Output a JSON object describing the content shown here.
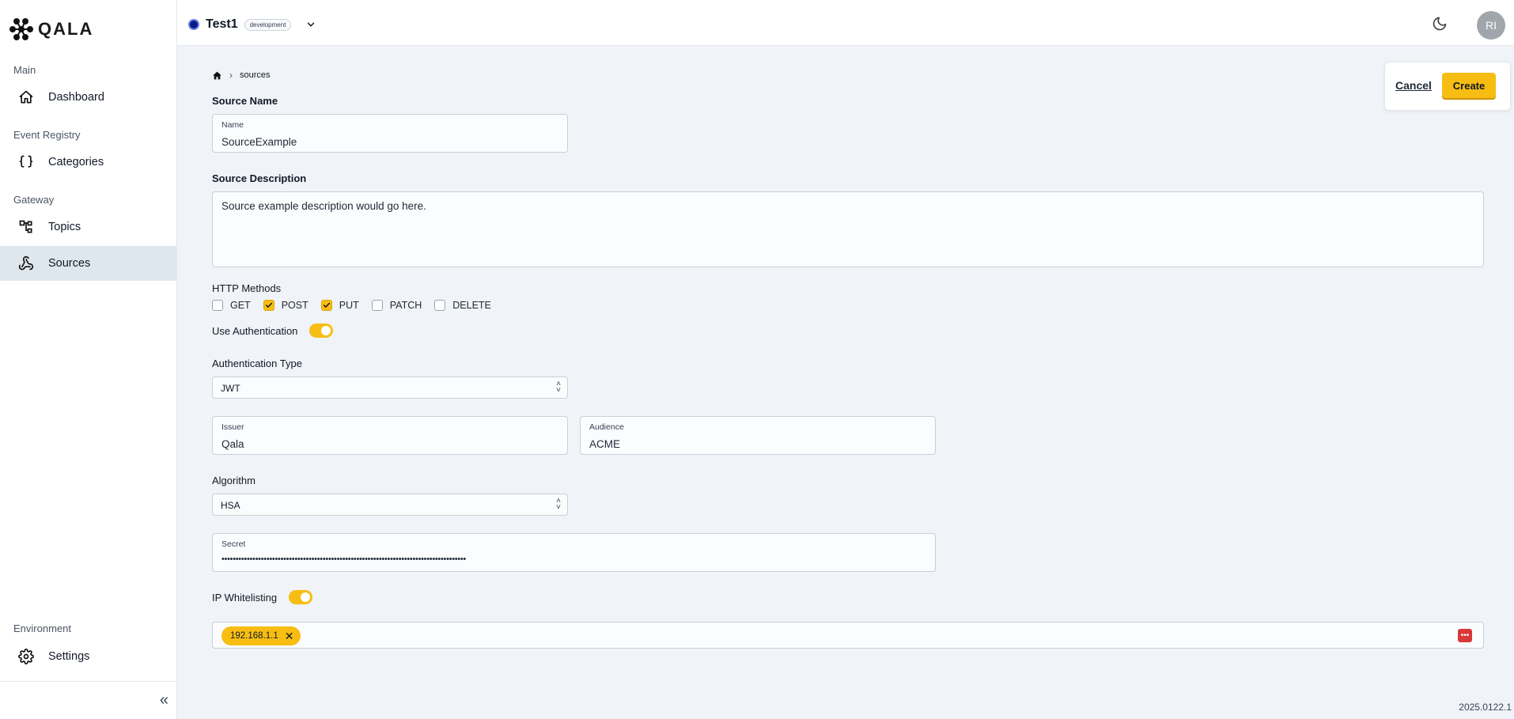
{
  "brand": {
    "name": "QALA"
  },
  "sidebar": {
    "sections": {
      "main": "Main",
      "event_registry": "Event Registry",
      "gateway": "Gateway",
      "environment": "Environment"
    },
    "items": {
      "dashboard": "Dashboard",
      "categories": "Categories",
      "topics": "Topics",
      "sources": "Sources",
      "settings": "Settings"
    },
    "active": "sources"
  },
  "topbar": {
    "env_name": "Test1",
    "env_badge": "development",
    "avatar_initials": "RI"
  },
  "breadcrumb": {
    "current": "sources"
  },
  "actions": {
    "cancel": "Cancel",
    "create": "Create"
  },
  "form": {
    "source_name_heading": "Source Name",
    "name_label": "Name",
    "name_value": "SourceExample",
    "description_heading": "Source Description",
    "description_value": "Source example description would go here.",
    "http_methods_heading": "HTTP Methods",
    "methods": [
      {
        "label": "GET",
        "checked": false
      },
      {
        "label": "POST",
        "checked": true
      },
      {
        "label": "PUT",
        "checked": true
      },
      {
        "label": "PATCH",
        "checked": false
      },
      {
        "label": "DELETE",
        "checked": false
      }
    ],
    "use_auth_label": "Use Authentication",
    "use_auth_on": true,
    "auth_type_heading": "Authentication Type",
    "auth_type_value": "JWT",
    "issuer_label": "Issuer",
    "issuer_value": "Qala",
    "audience_label": "Audience",
    "audience_value": "ACME",
    "algorithm_heading": "Algorithm",
    "algorithm_value": "HSA",
    "secret_label": "Secret",
    "secret_value": "•••••••••••••••••••••••••••••••••••••••••••••••••••••••••••••••••••••••••••••••••••••••",
    "ip_whitelisting_label": "IP Whitelisting",
    "ip_whitelisting_on": true,
    "ip_chips": [
      "192.168.1.1"
    ]
  },
  "footer": {
    "version": "2025.0122.1"
  },
  "colors": {
    "accent": "#f7bd12",
    "danger": "#d93838",
    "env_dot": "#0a1a8c"
  }
}
